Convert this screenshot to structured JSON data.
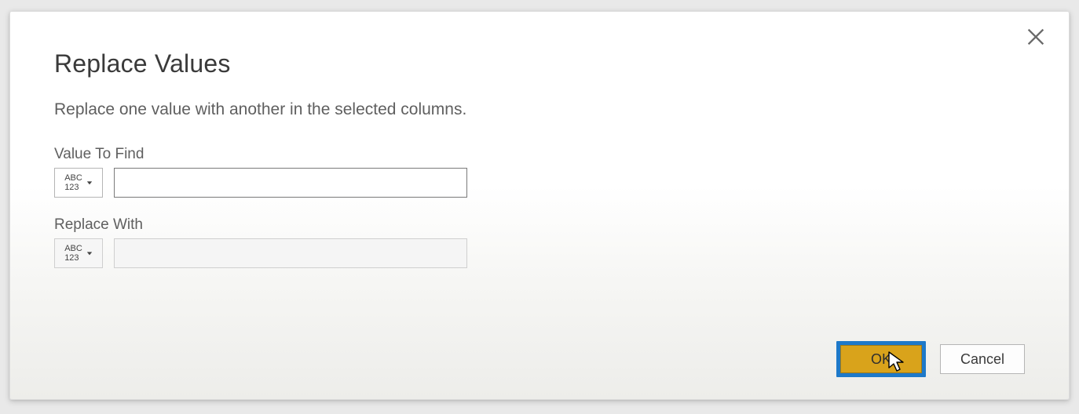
{
  "dialog": {
    "title": "Replace Values",
    "subtitle": "Replace one value with another in the selected columns.",
    "fields": {
      "find": {
        "label": "Value To Find",
        "type_icon_top": "ABC",
        "type_icon_bottom": "123",
        "value": ""
      },
      "replace": {
        "label": "Replace With",
        "type_icon_top": "ABC",
        "type_icon_bottom": "123",
        "value": ""
      }
    },
    "actions": {
      "ok": "OK",
      "cancel": "Cancel"
    }
  }
}
